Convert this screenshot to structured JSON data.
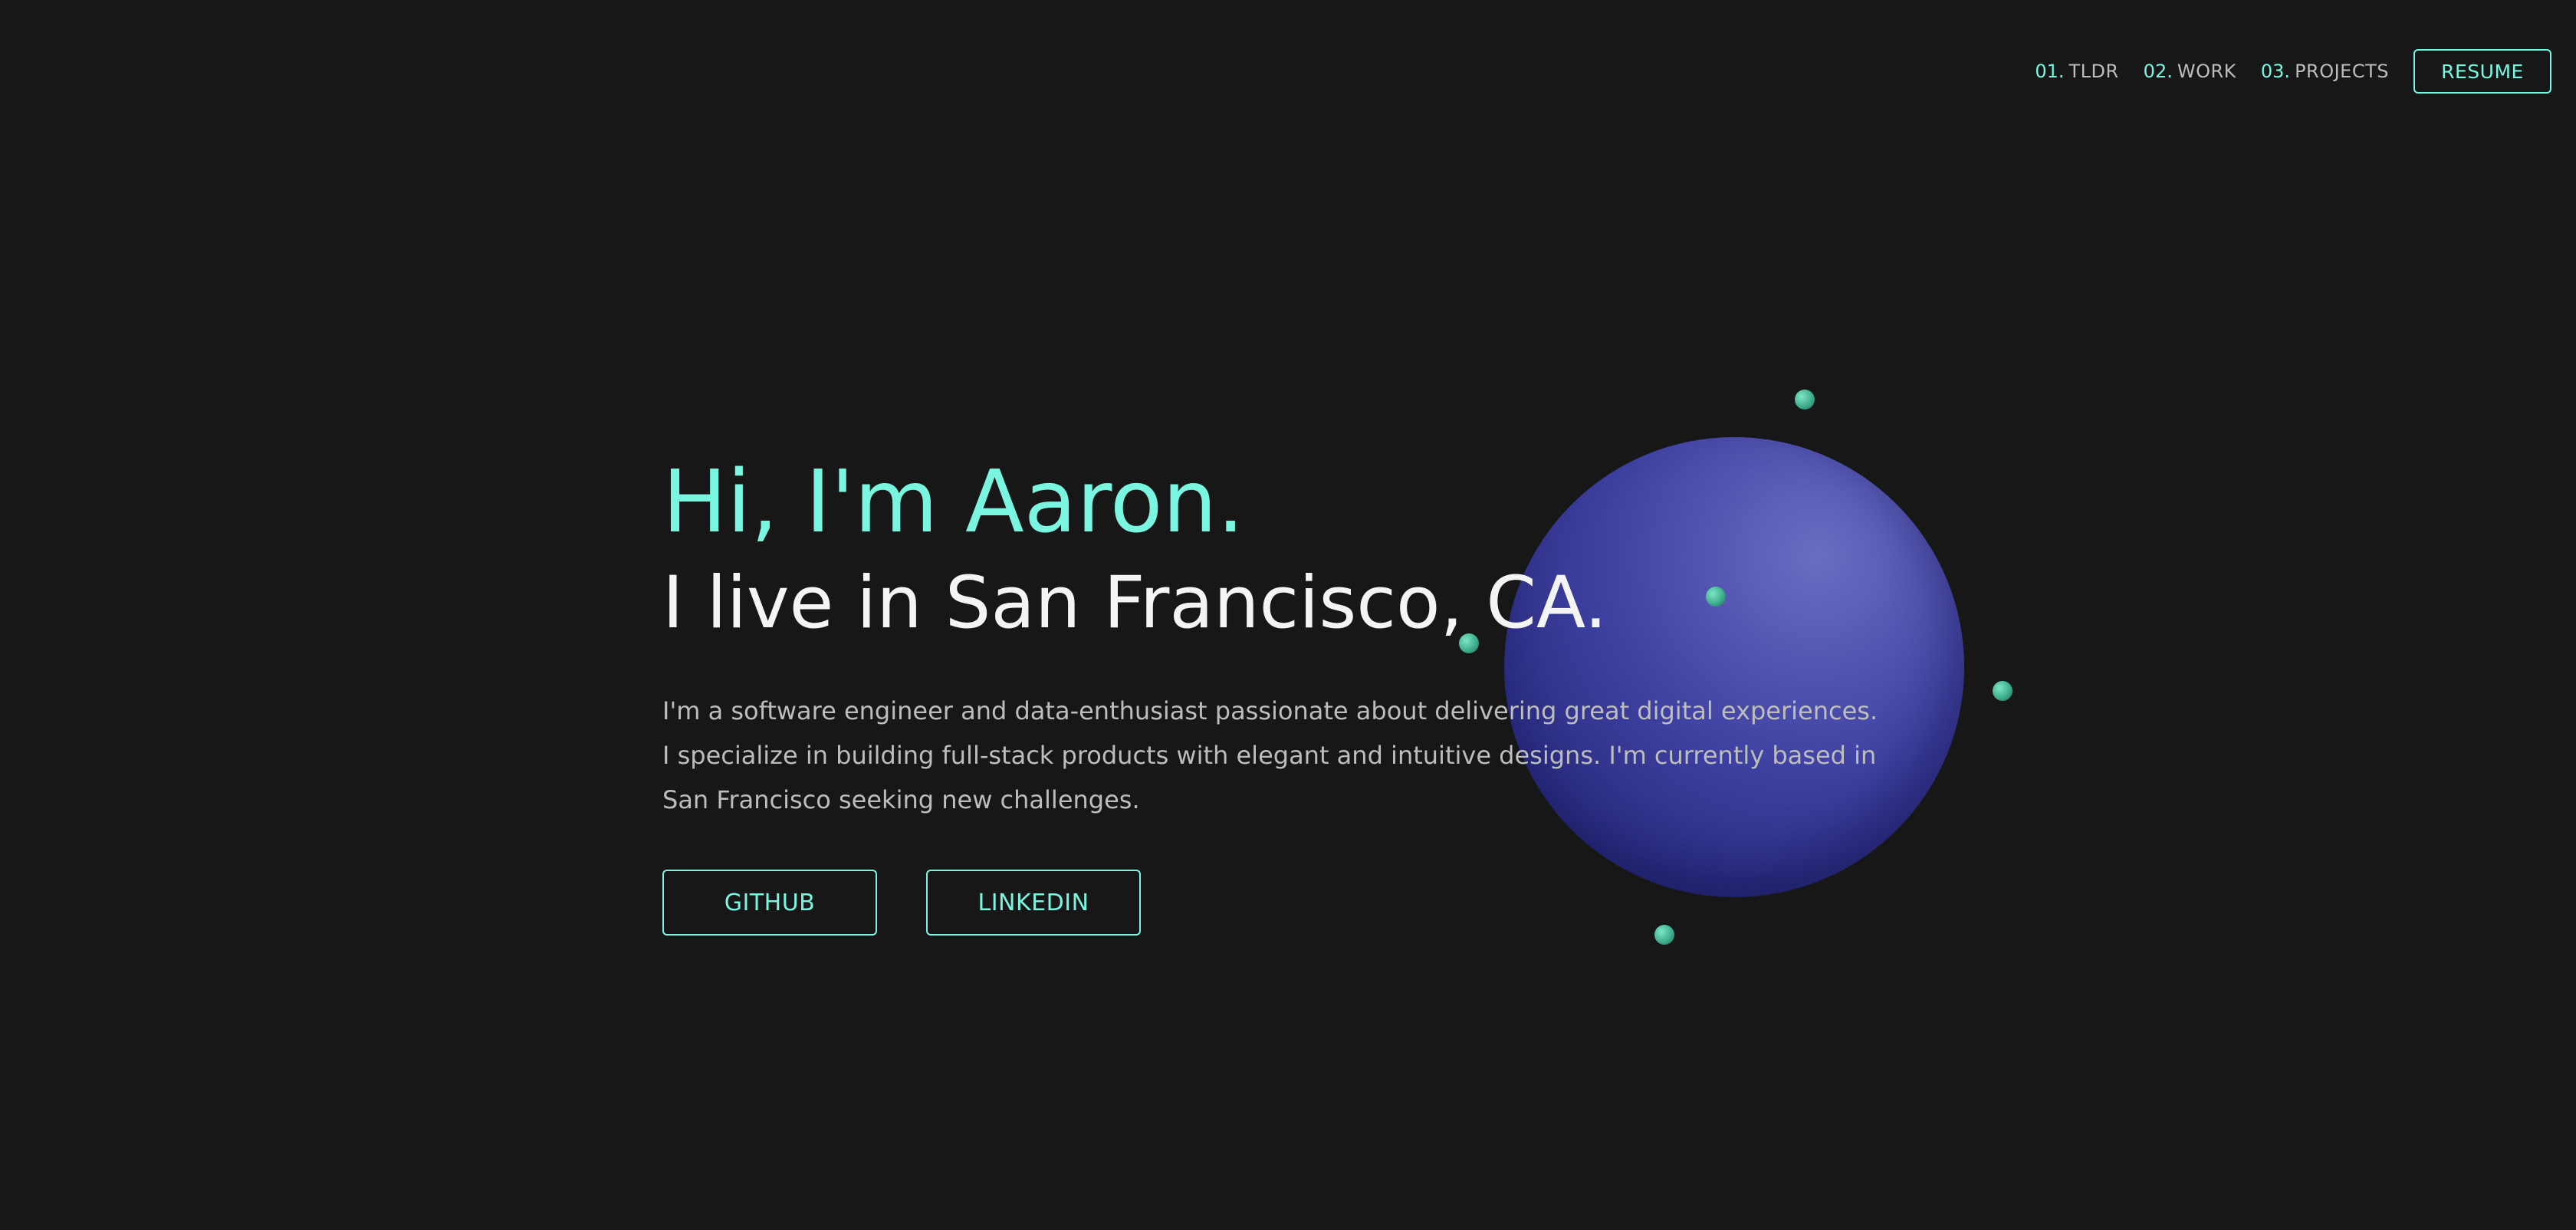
{
  "nav": {
    "items": [
      {
        "num": "01.",
        "label": "TLDR"
      },
      {
        "num": "02.",
        "label": "WORK"
      },
      {
        "num": "03.",
        "label": "PROJECTS"
      }
    ],
    "resume_label": "RESUME"
  },
  "hero": {
    "greeting": "Hi, I'm Aaron.",
    "location": "I live in San Francisco, CA.",
    "description": "I'm a software engineer and data-enthusiast passionate about delivering great digital experiences. I specialize in building full-stack products with elegant and intuitive designs. I'm currently based in San Francisco seeking new challenges.",
    "buttons": {
      "github": "GITHUB",
      "linkedin": "LINKEDIN"
    }
  },
  "colors": {
    "background": "#171717",
    "accent": "#7af5e0",
    "planet": "#4f51ac",
    "orbit_dots": "#3fae8f",
    "body_text": "#bdbdbd"
  }
}
